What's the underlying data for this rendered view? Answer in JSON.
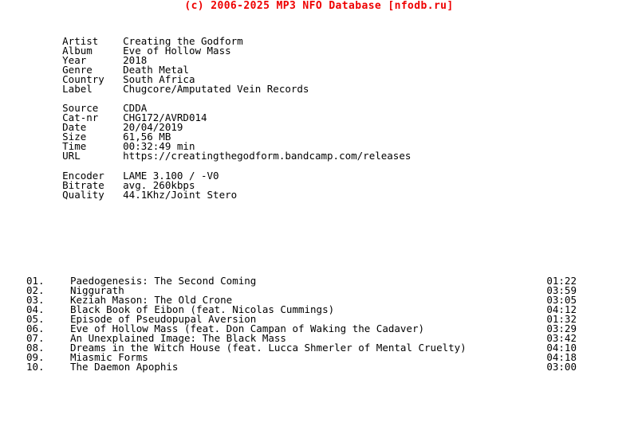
{
  "header": {
    "text": "(c) 2006-2025 MP3 NFO Database [nfodb.ru]",
    "color": "#ee0000"
  },
  "colors": {
    "background": "#ffffff",
    "text": "#000000",
    "accent": "#ee0000"
  },
  "release": {
    "rows": [
      {
        "label": "Artist",
        "value": "Creating the Godform"
      },
      {
        "label": "Album",
        "value": "Eve of Hollow Mass"
      },
      {
        "label": "Year",
        "value": "2018"
      },
      {
        "label": "Genre",
        "value": "Death Metal"
      },
      {
        "label": "Country",
        "value": "South Africa"
      },
      {
        "label": "Label",
        "value": "Chugcore/Amputated Vein Records"
      }
    ],
    "artist_label": "Artist",
    "artist_value": "Creating the Godform",
    "album_label": "Album",
    "album_value": "Eve of Hollow Mass",
    "year_label": "Year",
    "year_value": "2018",
    "genre_label": "Genre",
    "genre_value": "Death Metal",
    "country_label": "Country",
    "country_value": "South Africa",
    "label_label": "Label",
    "label_value": "Chugcore/Amputated Vein Records"
  },
  "source": {
    "source_label": "Source",
    "source_value": "CDDA",
    "catnr_label": "Cat-nr",
    "catnr_value": "CHG172/AVRD014",
    "date_label": "Date",
    "date_value": "20/04/2019",
    "size_label": "Size",
    "size_value": "61,56 MB",
    "time_label": "Time",
    "time_value": "00:32:49 min",
    "url_label": "URL",
    "url_value": "https://creatingthegodform.bandcamp.com/releases"
  },
  "audio": {
    "encoder_label": "Encoder",
    "encoder_value": "LAME 3.100 / -V0",
    "bitrate_label": "Bitrate",
    "bitrate_value": "avg. 260kbps",
    "quality_label": "Quality",
    "quality_value": "44.1Khz/Joint Stero"
  },
  "tracks": [
    {
      "num": "01.",
      "title": "Paedogenesis: The Second Coming",
      "time": "01:22"
    },
    {
      "num": "02.",
      "title": "Niggurath",
      "time": "03:59"
    },
    {
      "num": "03.",
      "title": "Keziah Mason: The Old Crone",
      "time": "03:05"
    },
    {
      "num": "04.",
      "title": "Black Book of Eibon (feat. Nicolas Cummings)",
      "time": "04:12"
    },
    {
      "num": "05.",
      "title": "Episode of Pseudopupal Aversion",
      "time": "01:32"
    },
    {
      "num": "06.",
      "title": "Eve of Hollow Mass (feat. Don Campan of Waking the Cadaver)",
      "time": "03:29"
    },
    {
      "num": "07.",
      "title": "An Unexplained Image: The Black Mass",
      "time": "03:42"
    },
    {
      "num": "08.",
      "title": "Dreams in the Witch House (feat. Lucca Shmerler of Mental Cruelty)",
      "time": "04:10"
    },
    {
      "num": "09.",
      "title": "Miasmic Forms",
      "time": "04:18"
    },
    {
      "num": "10.",
      "title": "The Daemon Apophis",
      "time": "03:00"
    }
  ]
}
